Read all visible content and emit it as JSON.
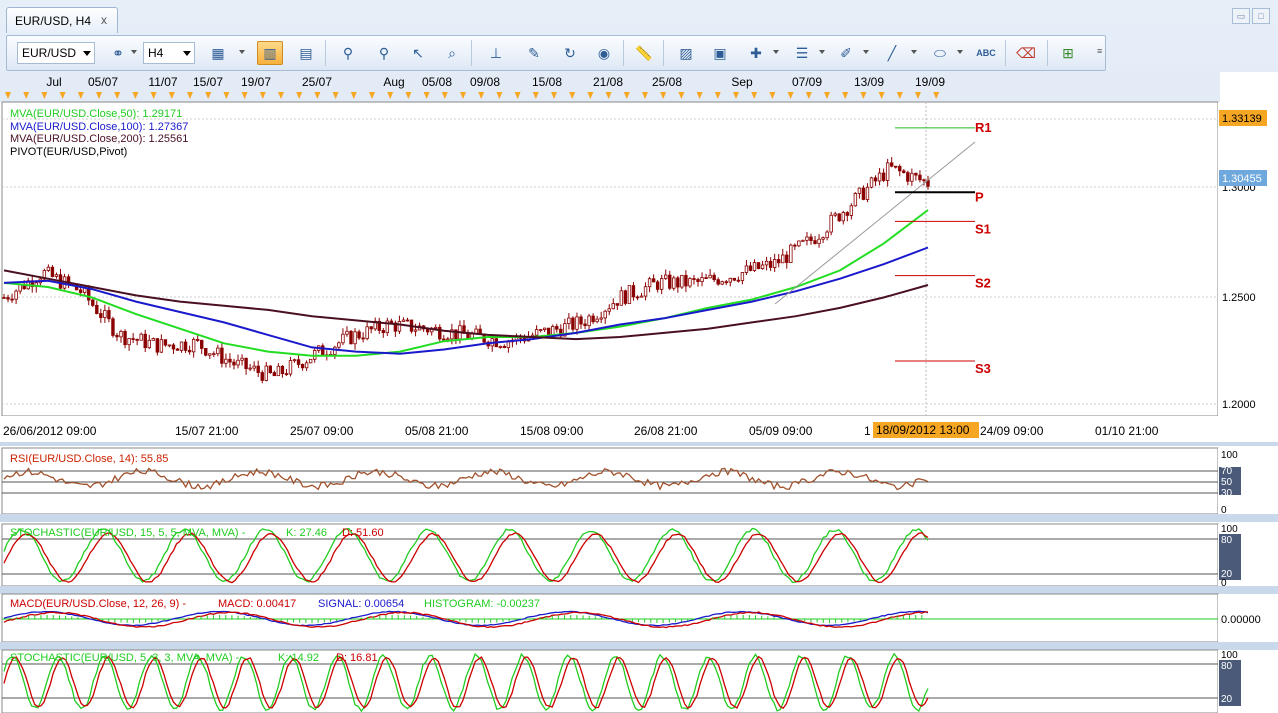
{
  "window": {
    "tab_title": "EUR/USD, H4",
    "close_glyph": "x"
  },
  "toolbar": {
    "symbol": "EUR/USD",
    "timeframe": "H4",
    "icon_names": [
      "link-icon",
      "chart-type-icon",
      "bar-chart-icon",
      "window-icon",
      "zoom-in-icon",
      "zoom-out-icon",
      "cursor-icon",
      "zoom-area-icon",
      "fit-icon",
      "properties-icon",
      "refresh-icon",
      "globe-icon",
      "ruler-icon",
      "image-icon",
      "template-icon",
      "crosshair-icon",
      "lines-icon",
      "pencil-icon",
      "line-tool-icon",
      "ellipse-icon",
      "text-abc-icon",
      "eraser-icon",
      "tree-icon"
    ],
    "text_tool": "ABC"
  },
  "top_axis": {
    "labels": [
      "Jul",
      "05/07",
      "11/07",
      "15/07",
      "19/07",
      "25/07",
      "Aug",
      "05/08",
      "09/08",
      "15/08",
      "21/08",
      "25/08",
      "Sep",
      "07/09",
      "13/09",
      "19/09"
    ]
  },
  "main_panel": {
    "legend": [
      {
        "text": "MVA(EUR/USD.Close,50): 1.29171",
        "color": "#22cc22"
      },
      {
        "text": "MVA(EUR/USD.Close,100): 1.27367",
        "color": "#1a1acc"
      },
      {
        "text": "MVA(EUR/USD.Close,200): 1.25561",
        "color": "#4a1020"
      },
      {
        "text": "PIVOT(EUR/USD,Pivot)",
        "color": "#000000"
      }
    ],
    "y_labels": [
      "1.3000",
      "1.2500",
      "1.2000"
    ],
    "price_tags": [
      {
        "text": "1.33139",
        "color": "#f5a623"
      },
      {
        "text": "1.30455",
        "color": "#6fa8dc"
      }
    ],
    "pivots": [
      {
        "name": "R1",
        "value": 1.3314,
        "color": "#22bb22"
      },
      {
        "name": "P",
        "value": 1.3005,
        "color": "#000000"
      },
      {
        "name": "S1",
        "value": 1.2865,
        "color": "#cc0000"
      },
      {
        "name": "S2",
        "value": 1.2605,
        "color": "#cc0000"
      },
      {
        "name": "S3",
        "value": 1.2195,
        "color": "#cc0000"
      }
    ],
    "x_labels": [
      "26/06/2012 09:00",
      "15/07 21:00",
      "25/07 09:00",
      "05/08 21:00",
      "15/08 09:00",
      "26/08 21:00",
      "05/09 09:00",
      "1",
      "24/09 09:00",
      "01/10 21:00"
    ],
    "cursor_label": "18/09/2012 13:00"
  },
  "rsi_panel": {
    "title": "RSI(EUR/USD.Close, 14): 55.85",
    "levels": [
      "100",
      "70",
      "50",
      "30",
      "0"
    ]
  },
  "stoch1_panel": {
    "title": "STOCHASTIC(EUR/USD, 15, 5, 5, MVA, MVA) -",
    "k": "K: 27.46",
    "d": "D: 51.60",
    "levels": [
      "100",
      "80",
      "20",
      "0"
    ]
  },
  "macd_panel": {
    "title": "MACD(EUR/USD.Close, 12, 26, 9) -",
    "macd": "MACD: 0.00417",
    "signal": "SIGNAL: 0.00654",
    "histogram": "HISTOGRAM: -0.00237",
    "level": "0.00000"
  },
  "stoch2_panel": {
    "title": "STOCHASTIC(EUR/USD, 5, 3, 3, MVA, MVA) -",
    "k": "K: 14.92",
    "d": "D: 16.81",
    "levels": [
      "100",
      "80",
      "20"
    ]
  },
  "chart_data": {
    "type": "line",
    "series": [
      {
        "name": "MVA(EUR/USD.Close,50)",
        "values": [
          1.257,
          1.255,
          1.25,
          1.242,
          1.235,
          1.228,
          1.224,
          1.222,
          1.222,
          1.224,
          1.229,
          1.231,
          1.231,
          1.233,
          1.236,
          1.24,
          1.245,
          1.249,
          1.255,
          1.263,
          1.276,
          1.292
        ]
      },
      {
        "name": "MVA(EUR/USD.Close,100)",
        "values": [
          1.257,
          1.258,
          1.254,
          1.248,
          1.243,
          1.238,
          1.232,
          1.226,
          1.224,
          1.223,
          1.225,
          1.228,
          1.23,
          1.233,
          1.237,
          1.24,
          1.244,
          1.248,
          1.253,
          1.259,
          1.266,
          1.274
        ]
      },
      {
        "name": "MVA(EUR/USD.Close,200)",
        "values": [
          1.263,
          1.259,
          1.255,
          1.251,
          1.248,
          1.246,
          1.244,
          1.241,
          1.239,
          1.237,
          1.234,
          1.232,
          1.231,
          1.23,
          1.231,
          1.233,
          1.235,
          1.238,
          1.241,
          1.245,
          1.25,
          1.256
        ]
      },
      {
        "name": "EUR/USD H4",
        "values": [
          1.25,
          1.262,
          1.253,
          1.232,
          1.227,
          1.228,
          1.218,
          1.212,
          1.222,
          1.231,
          1.237,
          1.235,
          1.232,
          1.229,
          1.233,
          1.238,
          1.25,
          1.257,
          1.257,
          1.261,
          1.266,
          1.278,
          1.295,
          1.312,
          1.305
        ]
      }
    ],
    "ylim": [
      1.195,
      1.34
    ],
    "grid": true
  }
}
